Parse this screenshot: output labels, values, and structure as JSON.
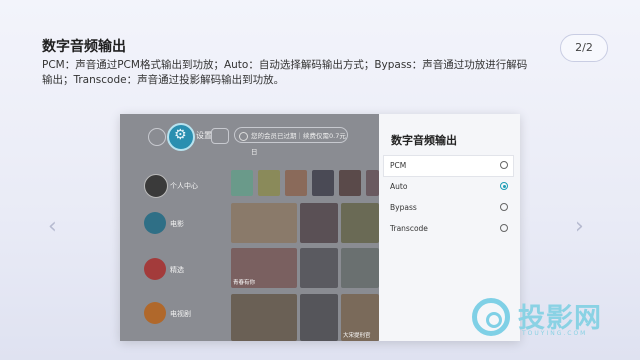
{
  "page": {
    "title": "数字音频输出",
    "description": "PCM：声音通过PCM格式输出到功放；Auto：自动选择解码输出方式；Bypass：声音通过功放进行解码输出；Transcode：声音通过投影解码输出到功放。",
    "pager": "2/2",
    "prev_icon": "‹",
    "next_icon": "›"
  },
  "tv": {
    "settings_label": "设置",
    "vip_text": "您的会员已过期｜续费仅需0.7元日",
    "sidebar": [
      {
        "label": "个人中心",
        "icon": "avatar-icon"
      },
      {
        "label": "电影",
        "icon": "film-reel-icon"
      },
      {
        "label": "精选",
        "icon": "featured-icon"
      },
      {
        "label": "电视剧",
        "icon": "tv-series-icon"
      }
    ],
    "tile_labels": [
      "青春有你",
      "大宋提刑官"
    ],
    "colors": {
      "accent": "#2a8fb0",
      "radio_selected": "#1e9db5"
    }
  },
  "panel": {
    "title": "数字音频输出",
    "options": [
      {
        "label": "PCM",
        "selected": false,
        "focused": true
      },
      {
        "label": "Auto",
        "selected": true,
        "focused": false
      },
      {
        "label": "Bypass",
        "selected": false,
        "focused": false
      },
      {
        "label": "Transcode",
        "selected": false,
        "focused": false
      }
    ]
  },
  "watermark": {
    "text": "投影网",
    "sub": "TOUYING.COM"
  }
}
